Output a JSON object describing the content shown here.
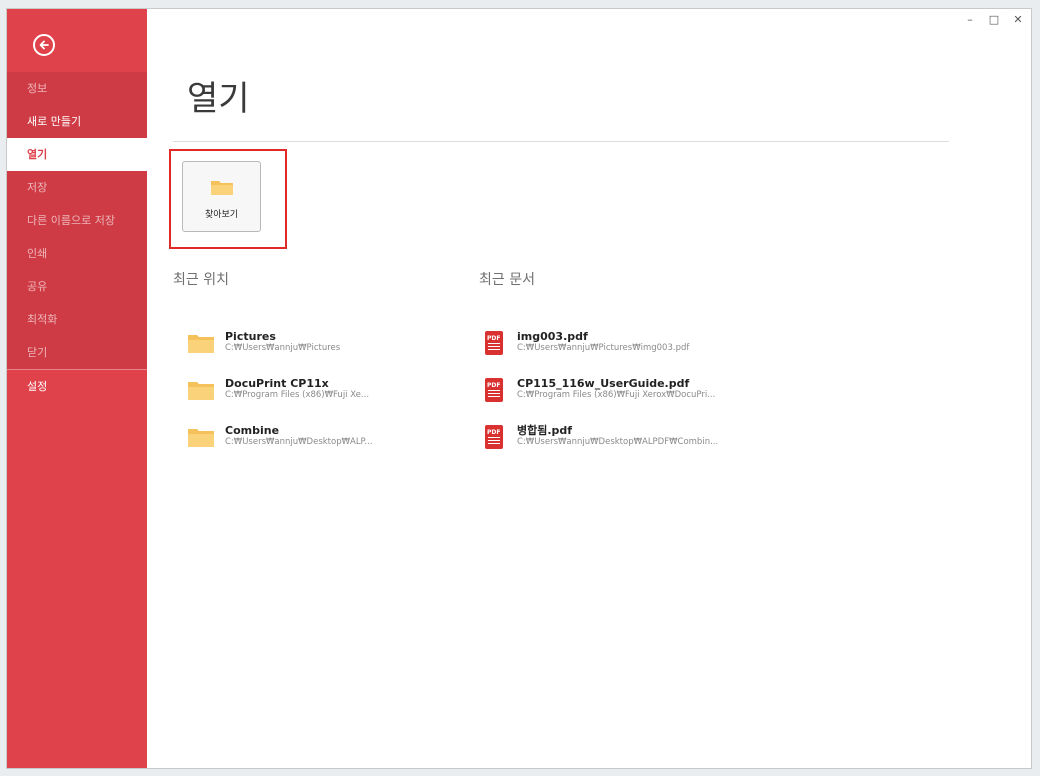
{
  "window_controls": {
    "minimize": "–",
    "maximize": "□",
    "close": "✕"
  },
  "sidebar": {
    "back_icon": "back-arrow-icon",
    "items": [
      {
        "label": "정보"
      },
      {
        "label": "새로 만들기"
      },
      {
        "label": "열기"
      },
      {
        "label": "저장"
      },
      {
        "label": "다른 이름으로 저장"
      },
      {
        "label": "인쇄"
      },
      {
        "label": "공유"
      },
      {
        "label": "최적화"
      },
      {
        "label": "닫기"
      },
      {
        "label": "설정"
      }
    ]
  },
  "main": {
    "title": "열기",
    "browse_label": "찾아보기",
    "recent_locations_title": "최근 위치",
    "recent_documents_title": "최근 문서"
  },
  "recent_locations": [
    {
      "name": "Pictures",
      "path": "C:₩Users₩annju₩Pictures"
    },
    {
      "name": "DocuPrint CP11x",
      "path": "C:₩Program Files (x86)₩Fuji Xe..."
    },
    {
      "name": "Combine",
      "path": "C:₩Users₩annju₩Desktop₩ALP..."
    }
  ],
  "recent_documents": [
    {
      "name": "img003.pdf",
      "path": "C:₩Users₩annju₩Pictures₩img003.pdf"
    },
    {
      "name": "CP115_116w_UserGuide.pdf",
      "path": "C:₩Program Files (x86)₩Fuji Xerox₩DocuPri..."
    },
    {
      "name": "병합됨.pdf",
      "path": "C:₩Users₩annju₩Desktop₩ALPDF₩Combin..."
    }
  ],
  "colors": {
    "accent": "#e0424c",
    "highlight": "#e02a2a",
    "folder": "#f5c15a",
    "pdf": "#d93030"
  }
}
